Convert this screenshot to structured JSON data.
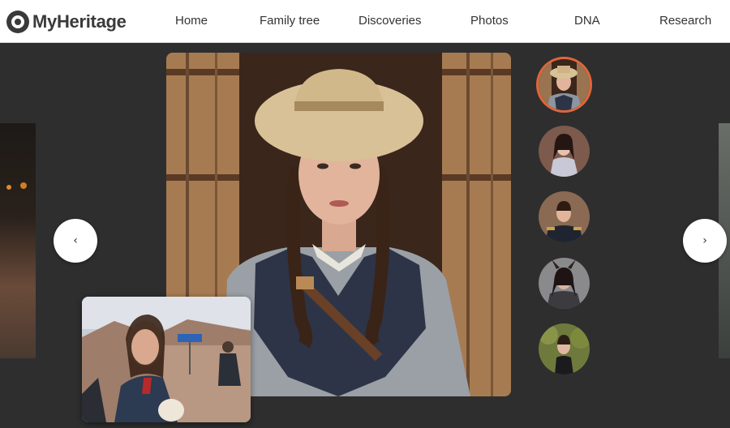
{
  "brand": {
    "name": "MyHeritage",
    "logo_icon": "myheritage-logo-icon"
  },
  "nav": {
    "items": [
      {
        "label": "Home"
      },
      {
        "label": "Family tree"
      },
      {
        "label": "Discoveries"
      },
      {
        "label": "Photos"
      },
      {
        "label": "DNA"
      },
      {
        "label": "Research"
      }
    ]
  },
  "carousel": {
    "prev_glyph": "‹",
    "next_glyph": "›",
    "prev_icon": "chevron-left-icon",
    "next_icon": "chevron-right-icon",
    "thumbnails": [
      {
        "subject": "cowgirl",
        "selected": true
      },
      {
        "subject": "victorian-lady",
        "selected": false
      },
      {
        "subject": "military-officer",
        "selected": false
      },
      {
        "subject": "horned-warrior",
        "selected": false
      },
      {
        "subject": "forest-dress",
        "selected": false
      }
    ]
  },
  "colors": {
    "accent": "#e0663a",
    "background": "#2e2e2e",
    "header_bg": "#ffffff"
  }
}
